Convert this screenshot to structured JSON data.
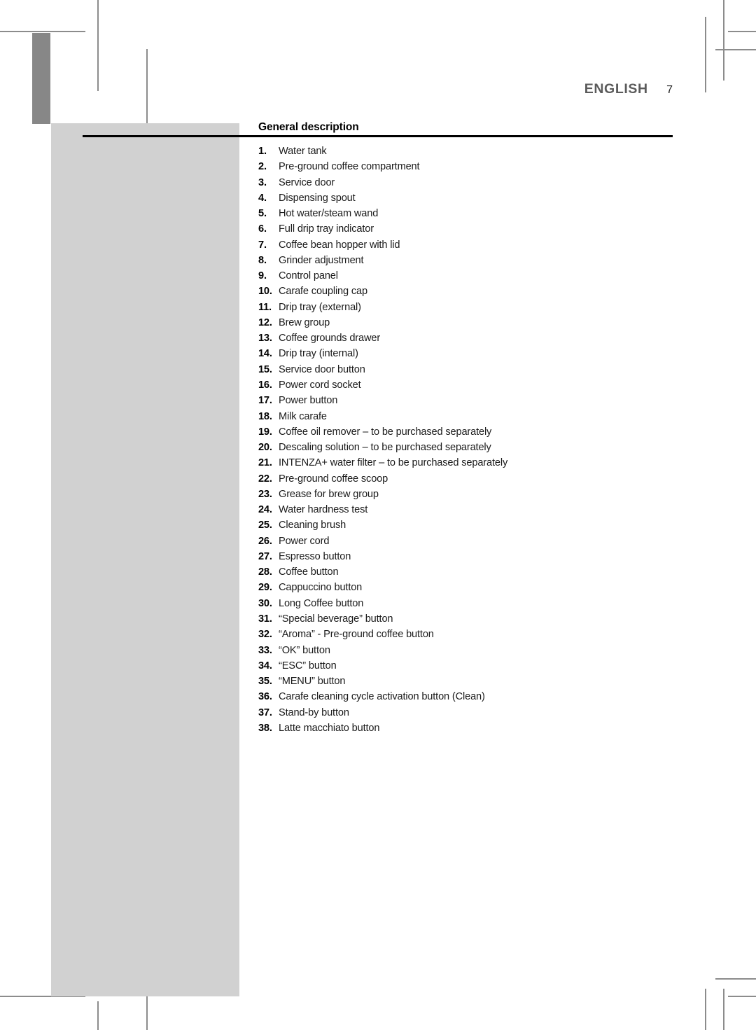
{
  "header": {
    "language": "ENGLISH",
    "page_number": "7"
  },
  "section": {
    "heading": "General description"
  },
  "parts_list": [
    {
      "num": "1.",
      "label": "Water tank"
    },
    {
      "num": "2.",
      "label": "Pre-ground coffee compartment"
    },
    {
      "num": "3.",
      "label": "Service door"
    },
    {
      "num": "4.",
      "label": "Dispensing spout"
    },
    {
      "num": "5.",
      "label": "Hot water/steam wand"
    },
    {
      "num": "6.",
      "label": "Full drip tray indicator"
    },
    {
      "num": "7.",
      "label": "Coffee bean hopper with lid"
    },
    {
      "num": "8.",
      "label": "Grinder adjustment"
    },
    {
      "num": "9.",
      "label": "Control panel"
    },
    {
      "num": "10.",
      "label": "Carafe coupling cap"
    },
    {
      "num": "11.",
      "label": "Drip tray (external)"
    },
    {
      "num": "12.",
      "label": "Brew group"
    },
    {
      "num": "13.",
      "label": "Coffee grounds drawer"
    },
    {
      "num": "14.",
      "label": "Drip tray (internal)"
    },
    {
      "num": "15.",
      "label": "Service door button"
    },
    {
      "num": "16.",
      "label": "Power cord socket"
    },
    {
      "num": "17.",
      "label": "Power button"
    },
    {
      "num": "18.",
      "label": "Milk carafe"
    },
    {
      "num": "19.",
      "label": "Coffee oil remover – to be purchased separately"
    },
    {
      "num": "20.",
      "label": "Descaling solution – to be purchased separately"
    },
    {
      "num": "21.",
      "label": "INTENZA+ water filter – to be purchased separately"
    },
    {
      "num": "22.",
      "label": "Pre-ground coffee scoop"
    },
    {
      "num": "23.",
      "label": "Grease for brew group"
    },
    {
      "num": "24.",
      "label": "Water hardness test"
    },
    {
      "num": "25.",
      "label": "Cleaning brush"
    },
    {
      "num": "26.",
      "label": "Power cord"
    },
    {
      "num": "27.",
      "label": "Espresso button"
    },
    {
      "num": "28.",
      "label": "Coffee button"
    },
    {
      "num": "29.",
      "label": "Cappuccino button"
    },
    {
      "num": "30.",
      "label": "Long Coffee button"
    },
    {
      "num": "31.",
      "label": "“Special beverage” button"
    },
    {
      "num": "32.",
      "label": "“Aroma” - Pre-ground coffee button"
    },
    {
      "num": "33.",
      "label": "“OK” button"
    },
    {
      "num": "34.",
      "label": "“ESC” button"
    },
    {
      "num": "35.",
      "label": "“MENU” button"
    },
    {
      "num": "36.",
      "label": "Carafe cleaning cycle activation button (Clean)"
    },
    {
      "num": "37.",
      "label": "Stand-by button"
    },
    {
      "num": "38.",
      "label": "Latte macchiato button"
    }
  ],
  "colors": {
    "chapter_tab": "#878787",
    "illustration_panel": "#d1d1d1",
    "header_text": "#5b5b5b",
    "crop_mark": "#8c8c8c",
    "rule": "#000000"
  }
}
